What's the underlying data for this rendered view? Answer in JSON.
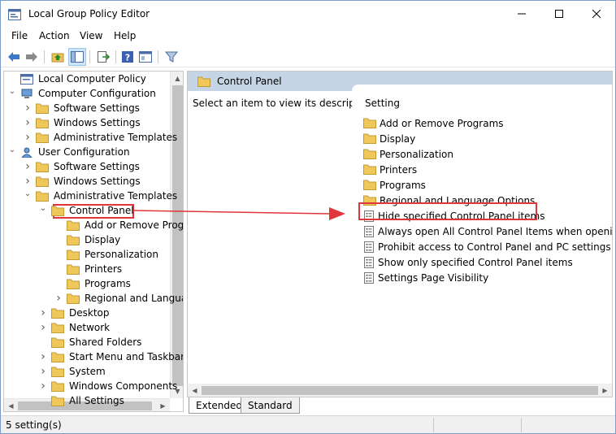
{
  "window": {
    "title": "Local Group Policy Editor",
    "minimize_label": "—",
    "maximize_label": "☐",
    "close_label": "✕"
  },
  "menu": [
    "File",
    "Action",
    "View",
    "Help"
  ],
  "toolbar": {
    "icons": [
      "back-icon",
      "forward-icon",
      "up-folder-icon",
      "show-hide-tree-icon",
      "export-list-icon",
      "help-icon",
      "properties-icon",
      "filter-icon"
    ]
  },
  "tree": {
    "items": [
      {
        "label": "Local Computer Policy",
        "expanded": true
      },
      {
        "label": "Computer Configuration",
        "expanded": true
      },
      {
        "label": "Software Settings",
        "expanded": false
      },
      {
        "label": "Windows Settings",
        "expanded": false
      },
      {
        "label": "Administrative Templates",
        "expanded": false
      },
      {
        "label": "User Configuration",
        "expanded": true
      },
      {
        "label": "Software Settings",
        "expanded": false
      },
      {
        "label": "Windows Settings",
        "expanded": false
      },
      {
        "label": "Administrative Templates",
        "expanded": true
      },
      {
        "label": "Control Panel",
        "expanded": true,
        "selected": true
      },
      {
        "label": "Add or Remove Programs"
      },
      {
        "label": "Display"
      },
      {
        "label": "Personalization"
      },
      {
        "label": "Printers"
      },
      {
        "label": "Programs"
      },
      {
        "label": "Regional and Language Options",
        "expanded": false
      },
      {
        "label": "Desktop",
        "expanded": false
      },
      {
        "label": "Network",
        "expanded": false
      },
      {
        "label": "Shared Folders"
      },
      {
        "label": "Start Menu and Taskbar",
        "expanded": false
      },
      {
        "label": "System",
        "expanded": false
      },
      {
        "label": "Windows Components",
        "expanded": false
      },
      {
        "label": "All Settings"
      }
    ]
  },
  "content": {
    "header_title": "Control Panel",
    "description": "Select an item to view its description.",
    "column_header": "Setting",
    "folders": [
      "Add or Remove Programs",
      "Display",
      "Personalization",
      "Printers",
      "Programs",
      "Regional and Language Options"
    ],
    "settings": [
      "Hide specified Control Panel items",
      "Always open All Control Panel Items when opening Control Panel",
      "Prohibit access to Control Panel and PC settings",
      "Show only specified Control Panel items",
      "Settings Page Visibility"
    ],
    "highlighted_setting": "Hide specified Control Panel items"
  },
  "tabs": [
    "Extended",
    "Standard"
  ],
  "status": {
    "text": "5 setting(s)"
  },
  "colors": {
    "highlight": "#e0353b",
    "header_bg": "#c5d5e6",
    "folder": "#e8c25c"
  }
}
